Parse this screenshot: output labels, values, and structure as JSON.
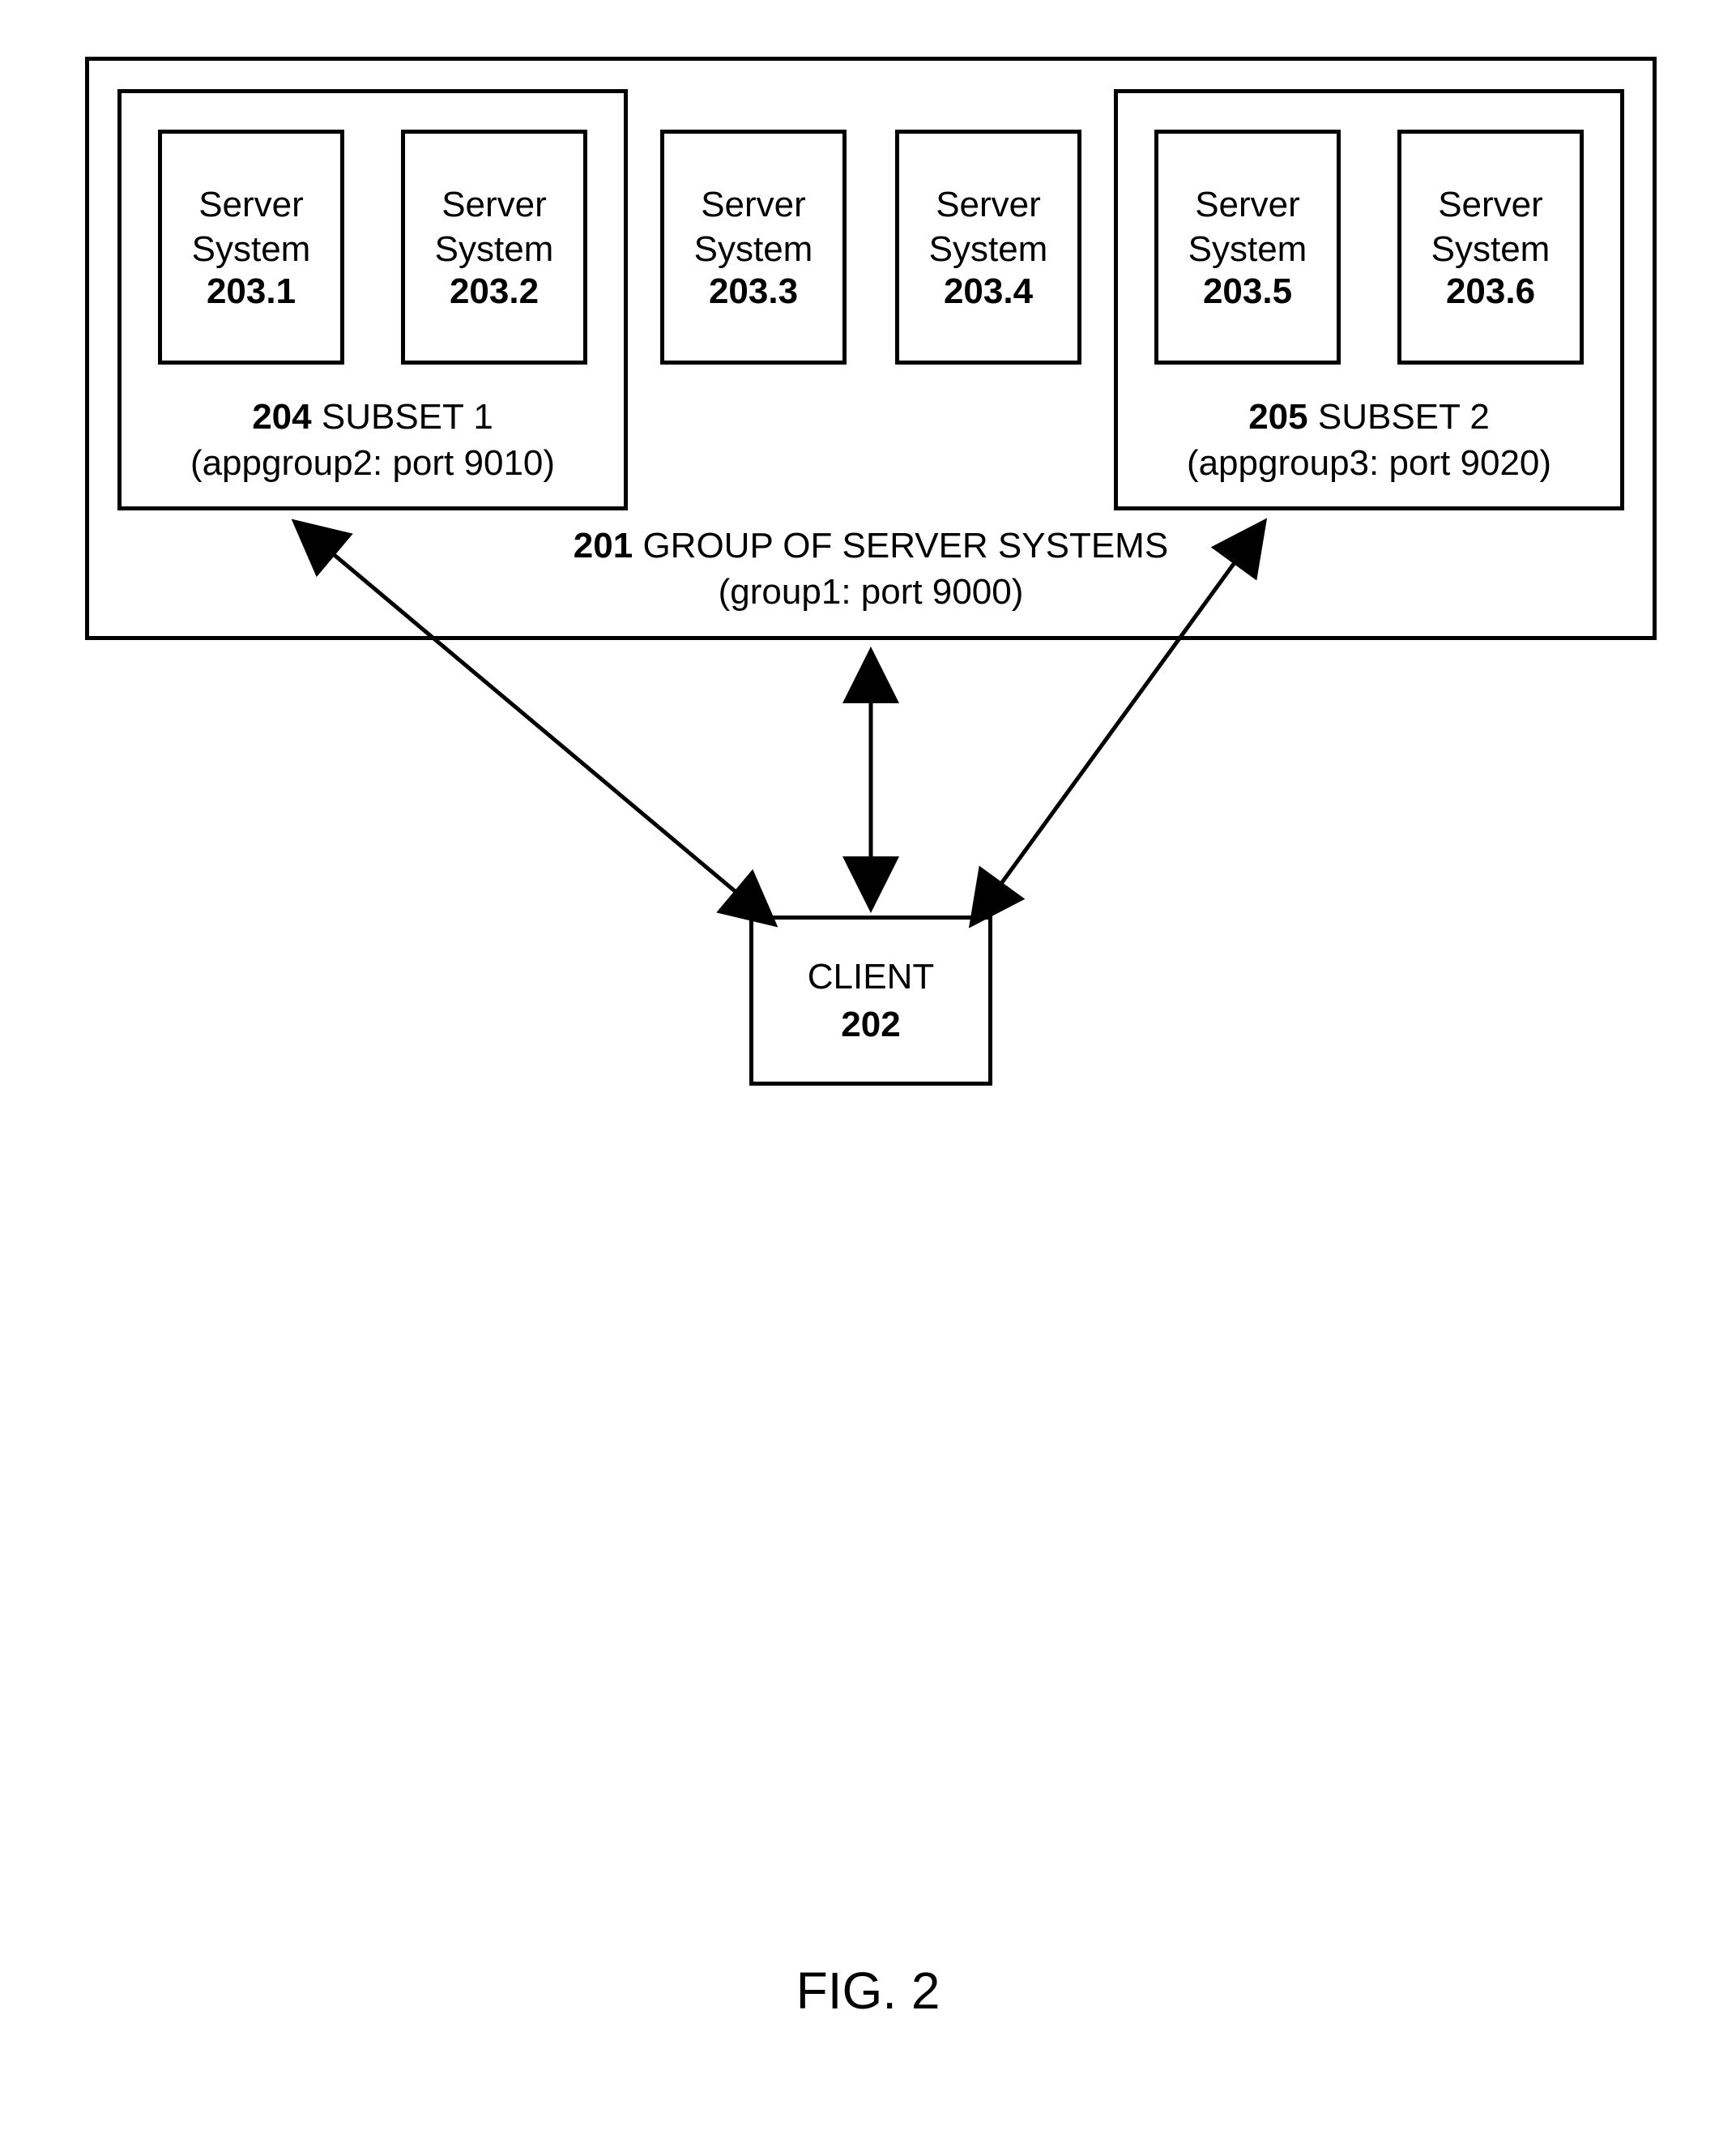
{
  "figure_label": "FIG. 2",
  "outer_group": {
    "ref_bold": "201",
    "title_rest": " GROUP OF SERVER SYSTEMS",
    "subtitle": "(group1: port 9000)"
  },
  "subset1": {
    "ref_bold": "204",
    "title_rest": " SUBSET 1",
    "subtitle": "(appgroup2: port 9010)"
  },
  "subset2": {
    "ref_bold": "205",
    "title_rest": " SUBSET 2",
    "subtitle": "(appgroup3: port 9020)"
  },
  "client": {
    "title": "CLIENT",
    "ref": "202"
  },
  "servers": [
    {
      "line1": "Server",
      "line2": "System",
      "ref": "203.1"
    },
    {
      "line1": "Server",
      "line2": "System",
      "ref": "203.2"
    },
    {
      "line1": "Server",
      "line2": "System",
      "ref": "203.3"
    },
    {
      "line1": "Server",
      "line2": "System",
      "ref": "203.4"
    },
    {
      "line1": "Server",
      "line2": "System",
      "ref": "203.5"
    },
    {
      "line1": "Server",
      "line2": "System",
      "ref": "203.6"
    }
  ]
}
